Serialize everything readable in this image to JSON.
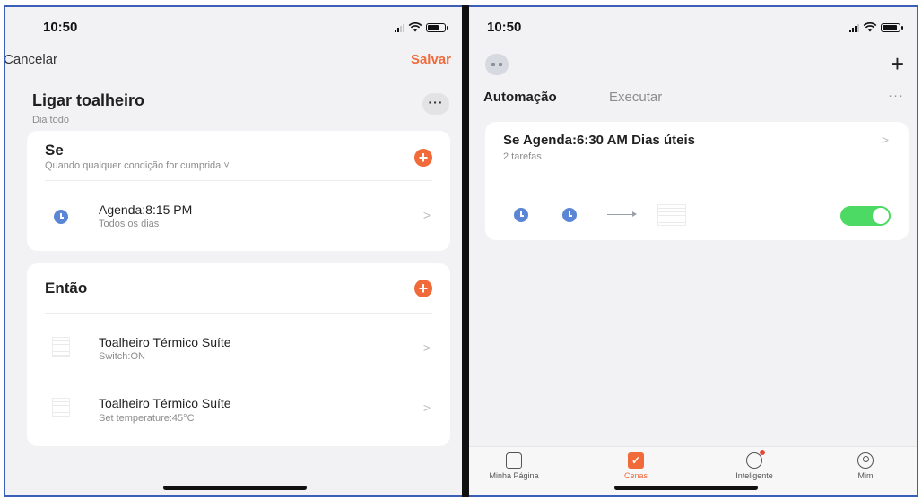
{
  "left": {
    "status_time": "10:50",
    "cancel_label": "Cancelar",
    "save_label": "Salvar",
    "rule_title": "Ligar toalheiro",
    "rule_subtitle": "Dia todo",
    "more_label": "···",
    "if_section": {
      "title": "Se",
      "subtitle": "Quando qualquer condição for cumprida ˅",
      "conditions": [
        {
          "title": "Agenda:8:15 PM",
          "subtitle": "Todos os dias",
          "icon": "clock-icon"
        }
      ]
    },
    "then_section": {
      "title": "Então",
      "actions": [
        {
          "title": "Toalheiro Térmico Suíte",
          "subtitle": "Switch:ON",
          "icon": "device-icon"
        },
        {
          "title": "Toalheiro Térmico Suíte",
          "subtitle": "Set temperature:45°C",
          "icon": "device-icon"
        }
      ]
    },
    "accent_color": "#f06a3a"
  },
  "right": {
    "status_time": "10:50",
    "add_label": "+",
    "tabs": {
      "automation": "Automação",
      "execute": "Executar",
      "more": "···"
    },
    "automation_card": {
      "title": "Se Agenda:6:30 AM Dias úteis",
      "subtitle": "2 tarefas",
      "enabled": true
    },
    "bottom_nav": [
      {
        "label": "Minha Página",
        "icon": "home-icon",
        "active": false
      },
      {
        "label": "Cenas",
        "icon": "scenes-icon",
        "active": true
      },
      {
        "label": "Inteligente",
        "icon": "smart-icon",
        "active": false
      },
      {
        "label": "Mim",
        "icon": "profile-icon",
        "active": false
      }
    ],
    "toggle_color": "#4cd964"
  },
  "chevron": ">"
}
